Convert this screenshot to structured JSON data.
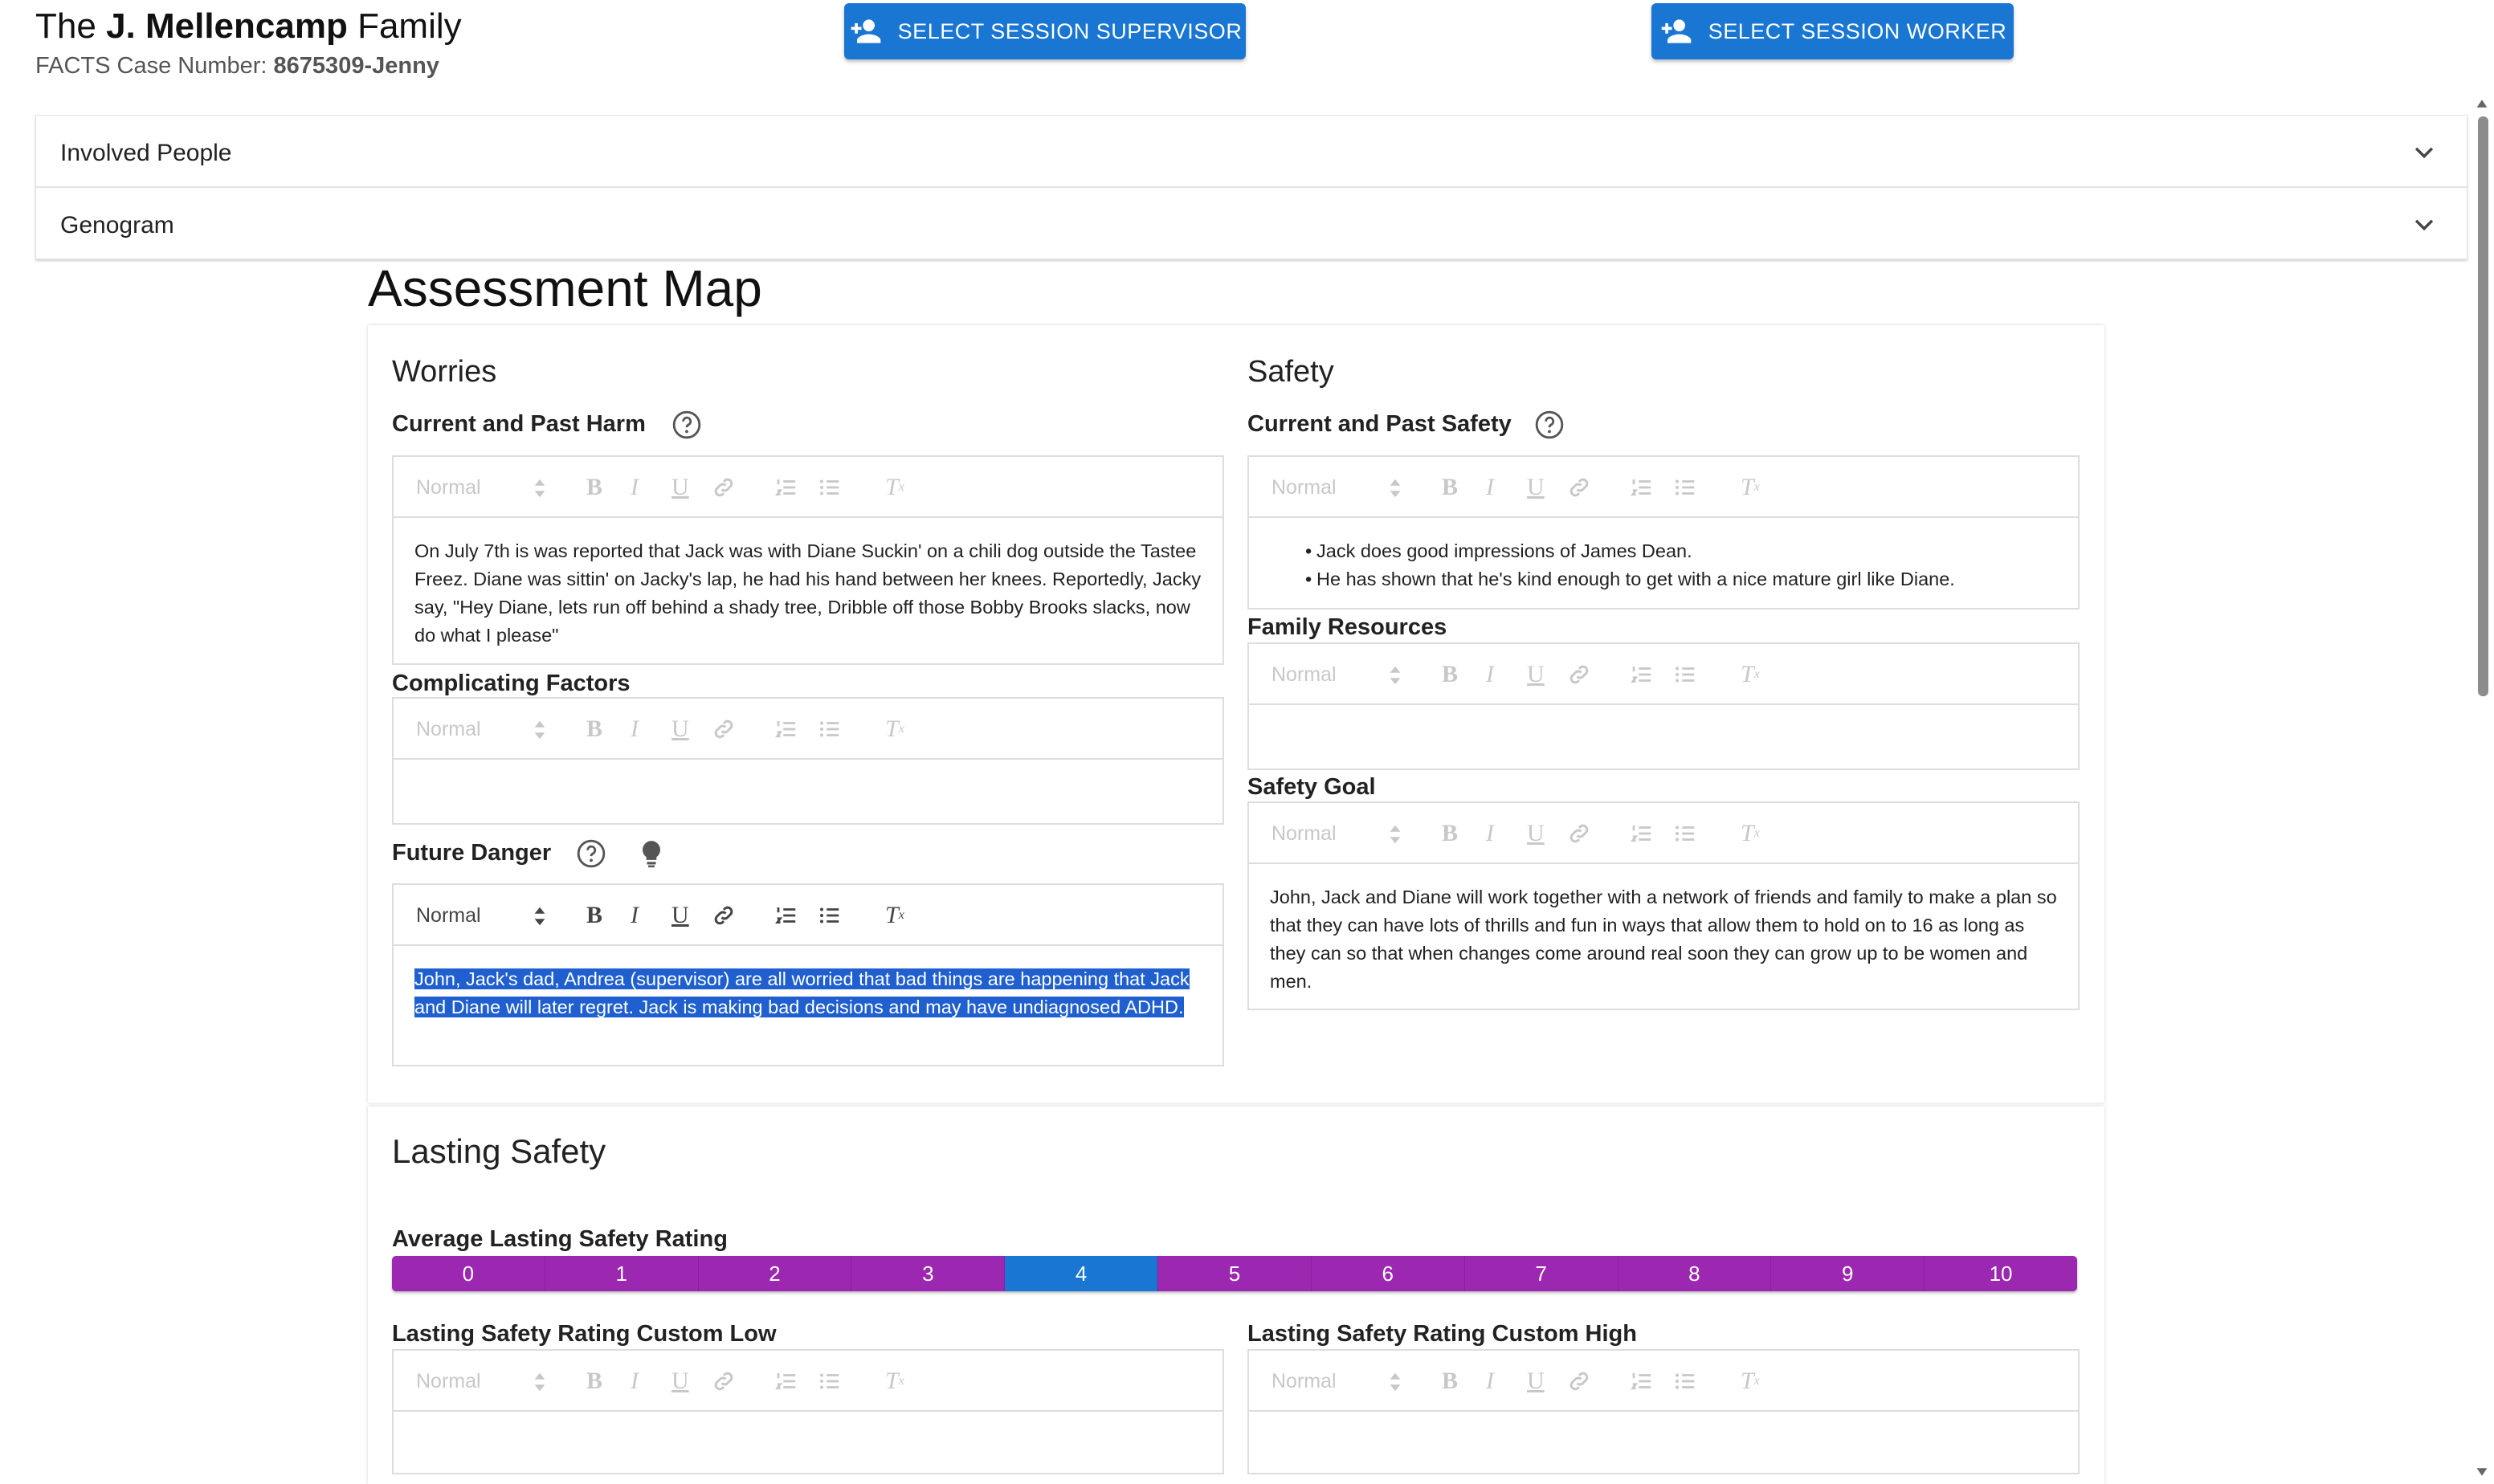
{
  "header": {
    "family_prefix": "The",
    "family_name": "J. Mellencamp",
    "family_suffix": "Family",
    "case_label": "FACTS Case Number:",
    "case_number": "8675309-Jenny",
    "supervisor_button": "SELECT SESSION SUPERVISOR",
    "worker_button": "SELECT SESSION WORKER"
  },
  "accordions": [
    {
      "label": "Involved People"
    },
    {
      "label": "Genogram"
    }
  ],
  "page_title": "Assessment Map",
  "editor_toolbar": {
    "format_select": "Normal"
  },
  "worries": {
    "title": "Worries",
    "current_past_harm": {
      "label": "Current and Past Harm",
      "text": "On July 7th is was reported that Jack was with Diane Suckin' on a chili dog outside the Tastee Freez. Diane was sittin' on Jacky's lap, he had his hand between her knees. Reportedly, Jacky say, \"Hey Diane, lets run off behind a shady tree, Dribble off those Bobby Brooks slacks, now do what I please\""
    },
    "complicating_factors": {
      "label": "Complicating Factors",
      "text": ""
    },
    "future_danger": {
      "label": "Future Danger",
      "text": "John, Jack's dad, Andrea (supervisor) are all worried that bad things are happening that Jack and Diane will later regret. Jack is making bad decisions and may have undiagnosed ADHD."
    }
  },
  "safety": {
    "title": "Safety",
    "current_past_safety": {
      "label": "Current and Past Safety",
      "items": [
        "Jack does good impressions of James Dean.",
        "He has shown that he's kind enough to get with a nice mature girl like Diane."
      ]
    },
    "family_resources": {
      "label": "Family Resources",
      "text": ""
    },
    "safety_goal": {
      "label": "Safety Goal",
      "text": "John, Jack and Diane will work together with a network of friends and family to make a plan so that they can have lots of thrills and fun in ways that allow them to hold on to 16 as long as they can so that when changes come around real soon they can grow up to be women and men."
    }
  },
  "lasting_safety": {
    "title": "Lasting Safety",
    "average_rating_label": "Average Lasting Safety Rating",
    "rating_options": [
      "0",
      "1",
      "2",
      "3",
      "4",
      "5",
      "6",
      "7",
      "8",
      "9",
      "10"
    ],
    "selected_rating": 4,
    "custom_low_label": "Lasting Safety Rating Custom Low",
    "custom_high_label": "Lasting Safety Rating Custom High"
  },
  "colors": {
    "primary": "#1976d2",
    "rating_purple": "#9c27b0",
    "selection": "#1f5fcf"
  },
  "icons": {
    "buttons": "person-add-icon",
    "accordion": "chevron-down-icon",
    "help": "help-circle-icon",
    "hint": "lightbulb-icon"
  }
}
